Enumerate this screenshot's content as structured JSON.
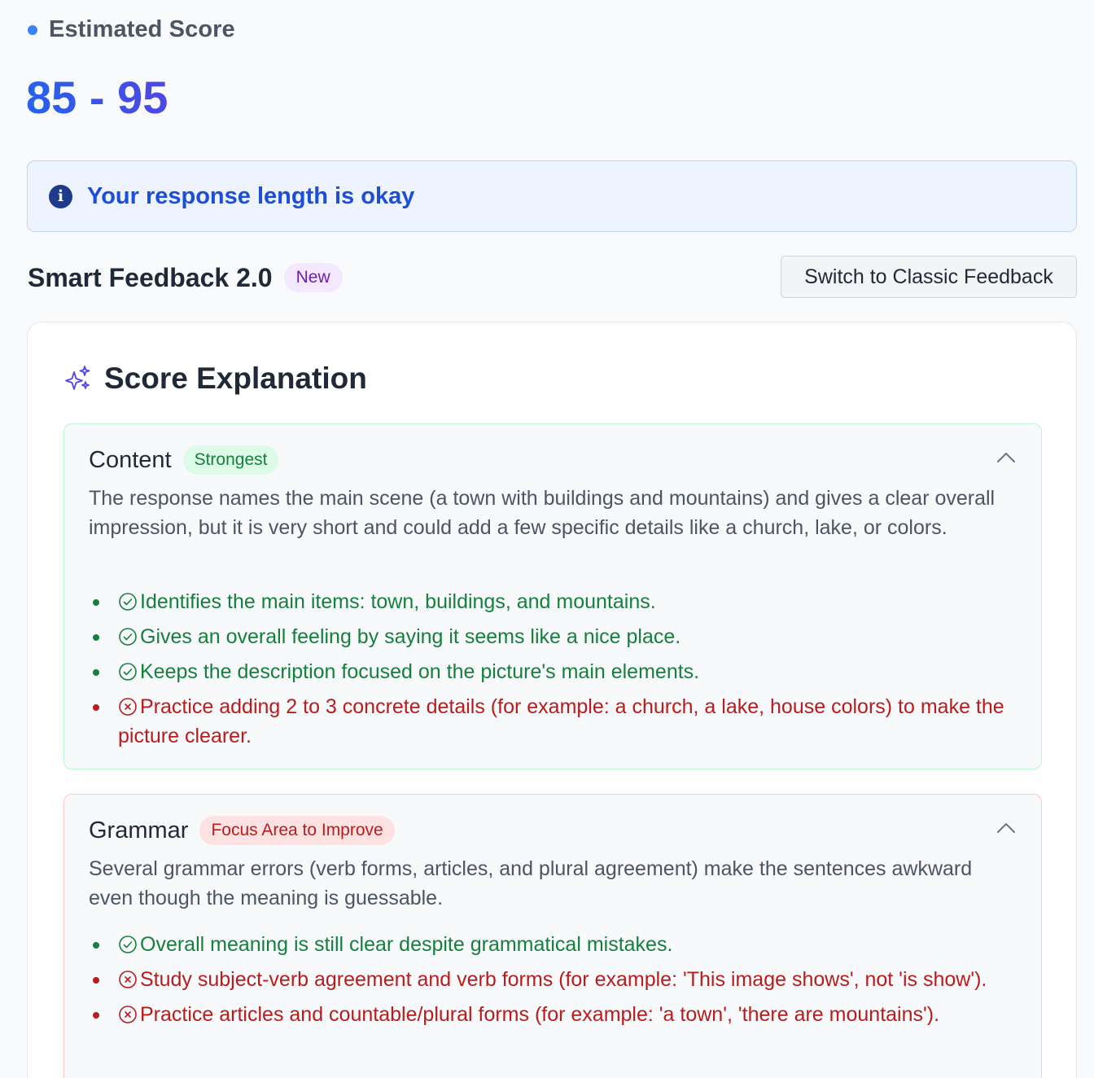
{
  "header": {
    "estimated_label": "Estimated Score",
    "score_range": "85 - 95"
  },
  "info_banner": {
    "icon": "info-icon",
    "text": "Your response length is okay"
  },
  "smart_feedback": {
    "title": "Smart Feedback 2.0",
    "badge": "New",
    "switch_button": "Switch to Classic Feedback"
  },
  "score_explanation": {
    "icon": "sparkles-icon",
    "title": "Score Explanation",
    "sections": [
      {
        "title": "Content",
        "tag": "Strongest",
        "description": "The response names the main scene (a town with buildings and mountains) and gives a clear overall impression, but it is very short and could add a few specific details like a church, lake, or colors.",
        "points": [
          {
            "type": "positive",
            "icon": "check-circle-icon",
            "text": "Identifies the main items: town, buildings, and mountains."
          },
          {
            "type": "positive",
            "icon": "check-circle-icon",
            "text": "Gives an overall feeling by saying it seems like a nice place."
          },
          {
            "type": "positive",
            "icon": "check-circle-icon",
            "text": "Keeps the description focused on the picture's main elements."
          },
          {
            "type": "negative",
            "icon": "x-circle-icon",
            "text": "Practice adding 2 to 3 concrete details (for example: a church, a lake, house colors) to make the picture clearer."
          }
        ]
      },
      {
        "title": "Grammar",
        "tag": "Focus Area to Improve",
        "description": "Several grammar errors (verb forms, articles, and plural agreement) make the sentences awkward even though the meaning is guessable.",
        "points": [
          {
            "type": "positive",
            "icon": "check-circle-icon",
            "text": "Overall meaning is still clear despite grammatical mistakes."
          },
          {
            "type": "negative",
            "icon": "x-circle-icon",
            "text": "Study subject-verb agreement and verb forms (for example: 'This image shows', not 'is show')."
          },
          {
            "type": "negative",
            "icon": "x-circle-icon",
            "text": "Practice articles and countable/plural forms (for example: 'a town', 'there are mountains')."
          }
        ]
      }
    ]
  },
  "colors": {
    "accent_blue": "#2563eb",
    "positive_green": "#15803d",
    "negative_red": "#b91c1c"
  }
}
